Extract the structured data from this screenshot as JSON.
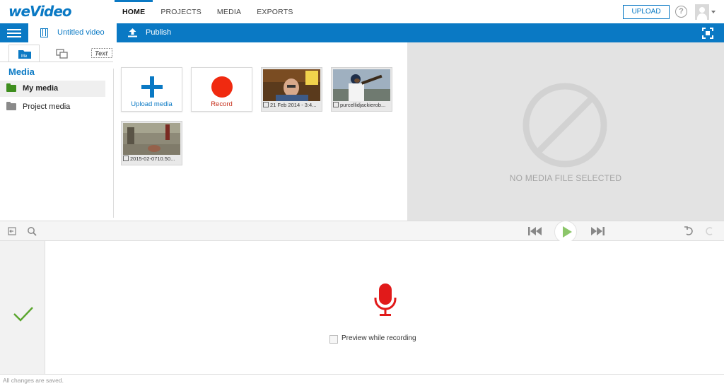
{
  "brand": {
    "logo_text": "weVideo",
    "accent_color": "#0a79c4"
  },
  "topnav": {
    "tabs": [
      {
        "label": "HOME",
        "active": true
      },
      {
        "label": "PROJECTS",
        "active": false
      },
      {
        "label": "MEDIA",
        "active": false
      },
      {
        "label": "EXPORTS",
        "active": false
      }
    ],
    "upload_label": "UPLOAD",
    "help_glyph": "?",
    "help_icon": "question-circle-icon",
    "avatar_icon": "user-avatar-icon"
  },
  "projectbar": {
    "menu_icon": "hamburger-menu-icon",
    "title": "Untitled video",
    "title_icon": "film-icon",
    "publish_label": "Publish",
    "publish_icon": "upload-arrow-icon",
    "fullscreen_icon": "fullscreen-icon"
  },
  "media_panel": {
    "tabs": [
      {
        "name": "media-tab",
        "icon": "media-folder-icon",
        "text": "Me",
        "active": true
      },
      {
        "name": "transitions-tab",
        "icon": "transitions-icon",
        "active": false
      },
      {
        "name": "text-tab",
        "icon": "text-icon",
        "text": "Text",
        "active": false
      }
    ],
    "heading": "Media",
    "folders": [
      {
        "label": "My media",
        "selected": true,
        "color": "#3e8e1e"
      },
      {
        "label": "Project media",
        "selected": false,
        "color": "#8a8a8a"
      }
    ],
    "actions": [
      {
        "label": "Upload media",
        "icon": "plus-icon",
        "color": "#0a79c4"
      },
      {
        "label": "Record",
        "icon": "record-icon",
        "color": "#c62e1a"
      }
    ],
    "items": [
      {
        "caption": "21 Feb 2014 - 3:4...",
        "type_icon": "video-file-icon"
      },
      {
        "caption": "purcellidjackierob...",
        "type_icon": "image-file-icon"
      },
      {
        "caption": "2015-02-0710.50...",
        "type_icon": "video-file-icon"
      }
    ]
  },
  "preview": {
    "empty_text": "NO MEDIA FILE SELECTED",
    "empty_icon": "no-entry-icon"
  },
  "toolbar": {
    "left_icons": [
      "exit-icon",
      "search-icon"
    ],
    "playback_icons": [
      "skip-back-icon",
      "play-icon",
      "skip-forward-icon"
    ],
    "history_icons": [
      "undo-icon",
      "redo-icon"
    ]
  },
  "recording": {
    "confirm_icon": "checkmark-icon",
    "mic_icon": "microphone-icon",
    "preview_checkbox_label": "Preview while recording",
    "preview_checked": false
  },
  "status": {
    "text": "All changes are saved."
  }
}
